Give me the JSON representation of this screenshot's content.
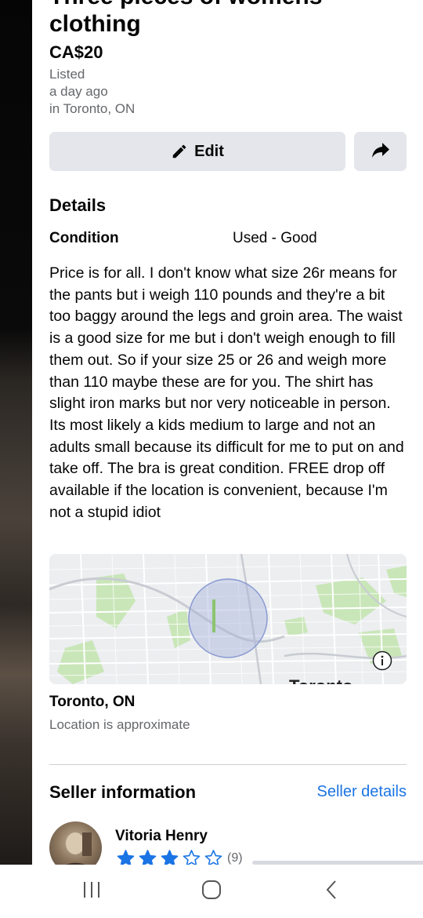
{
  "listing": {
    "title": "Three pieces of womens clothing",
    "price": "CA$20",
    "listed_label": "Listed",
    "listed_time": "a day ago",
    "listed_location": "in Toronto, ON"
  },
  "actions": {
    "edit_label": "Edit",
    "pencil_icon": "pencil-icon",
    "share_icon": "share-arrow-icon"
  },
  "details": {
    "heading": "Details",
    "condition_label": "Condition",
    "condition_value": "Used - Good",
    "description": "Price is for all. I don't know what size 26r means for the pants but i weigh 110 pounds and they're a bit too baggy around the legs and groin area. The waist is a good size for me but i don't weigh enough to fill them out. So if your size 25 or 26 and weigh more than 110 maybe these are for you. The shirt has slight iron marks but nor very noticeable in person. Its most likely a kids medium to large and not an adults small because its difficult for me to put on and take off. The bra is great condition. FREE drop off available if the location is convenient, because I'm not a stupid idiot"
  },
  "map": {
    "city_label": "Toronto",
    "info_icon": "info-icon",
    "location_title": "Toronto, ON",
    "location_note": "Location is approximate",
    "circle_color": "#8a9ad0"
  },
  "seller": {
    "heading": "Seller information",
    "details_link": "Seller details",
    "name": "Vitoria Henry",
    "rating": 3,
    "rating_max": 5,
    "rating_count": "(9)",
    "star_color": "#1b74e4"
  },
  "nav": {
    "recents_icon": "recent-apps-icon",
    "home_icon": "home-icon",
    "back_icon": "back-icon"
  }
}
